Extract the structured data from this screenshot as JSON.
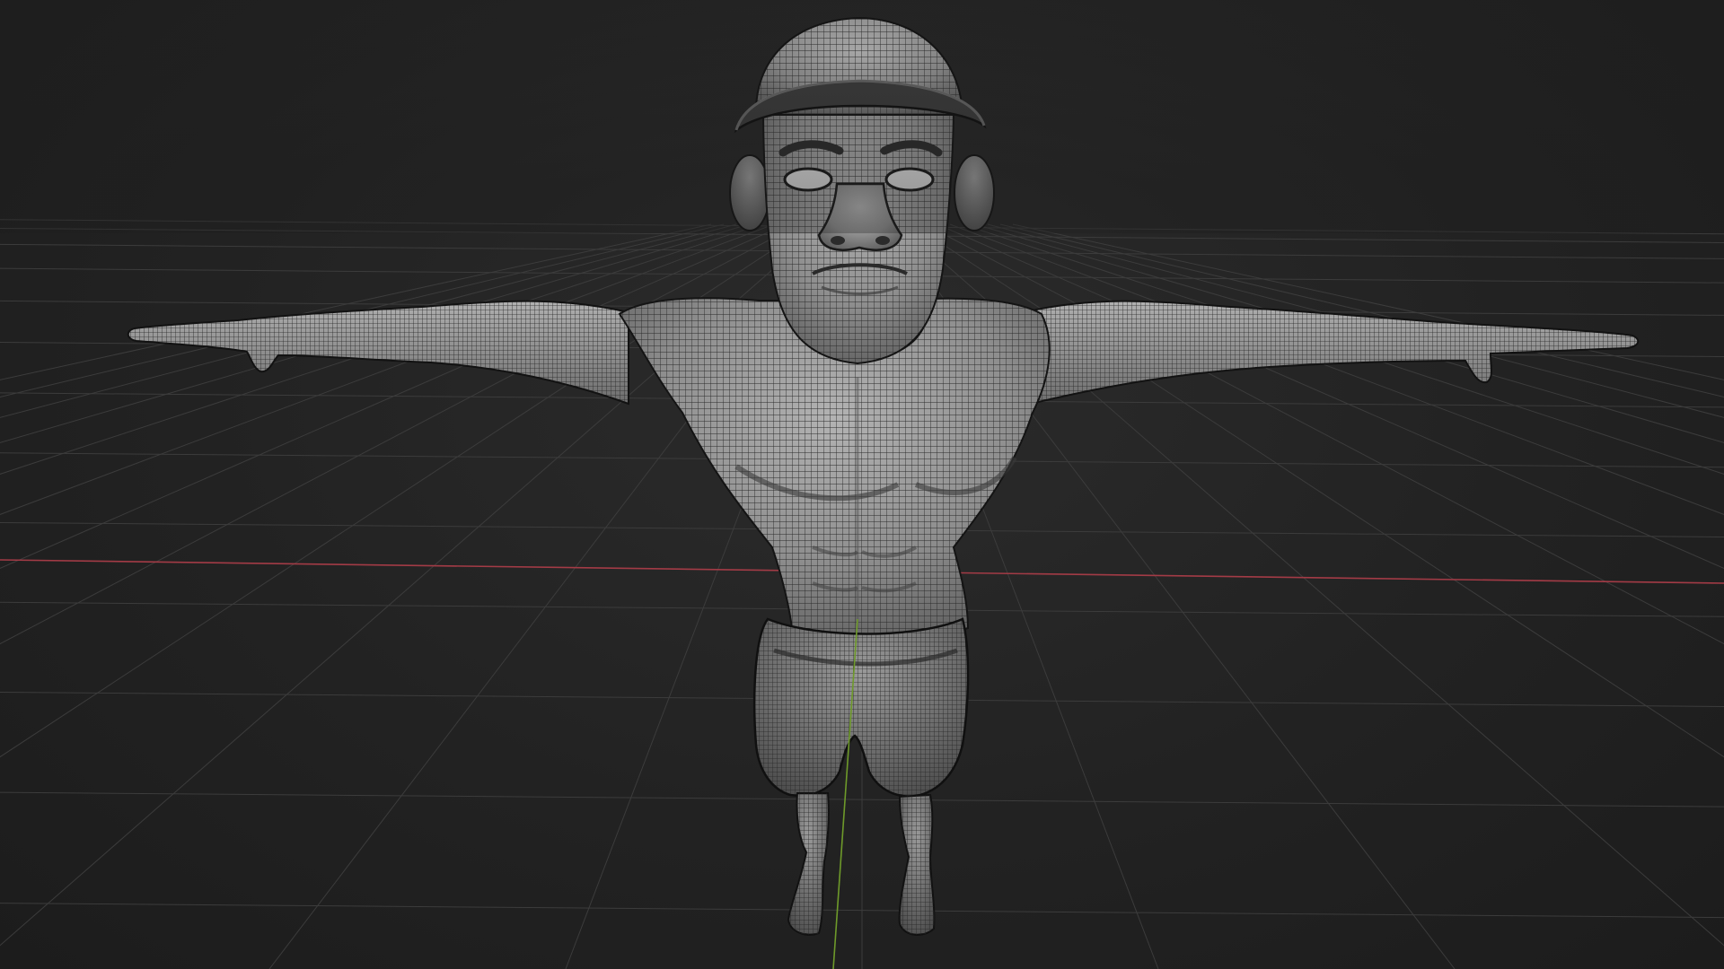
{
  "viewport": {
    "kind": "3d-viewport",
    "shading": "solid-with-wireframe-overlay",
    "background_color": "#242424",
    "grid_color": "#3c3c3c",
    "x_axis_color": "#a33b46",
    "y_axis_color": "#6e9a2a",
    "mesh_color": "#8c8c8c",
    "wire_color": "#2a2a2a"
  },
  "scene": {
    "object": "humanoid-character-mesh",
    "pose": "t-pose"
  }
}
